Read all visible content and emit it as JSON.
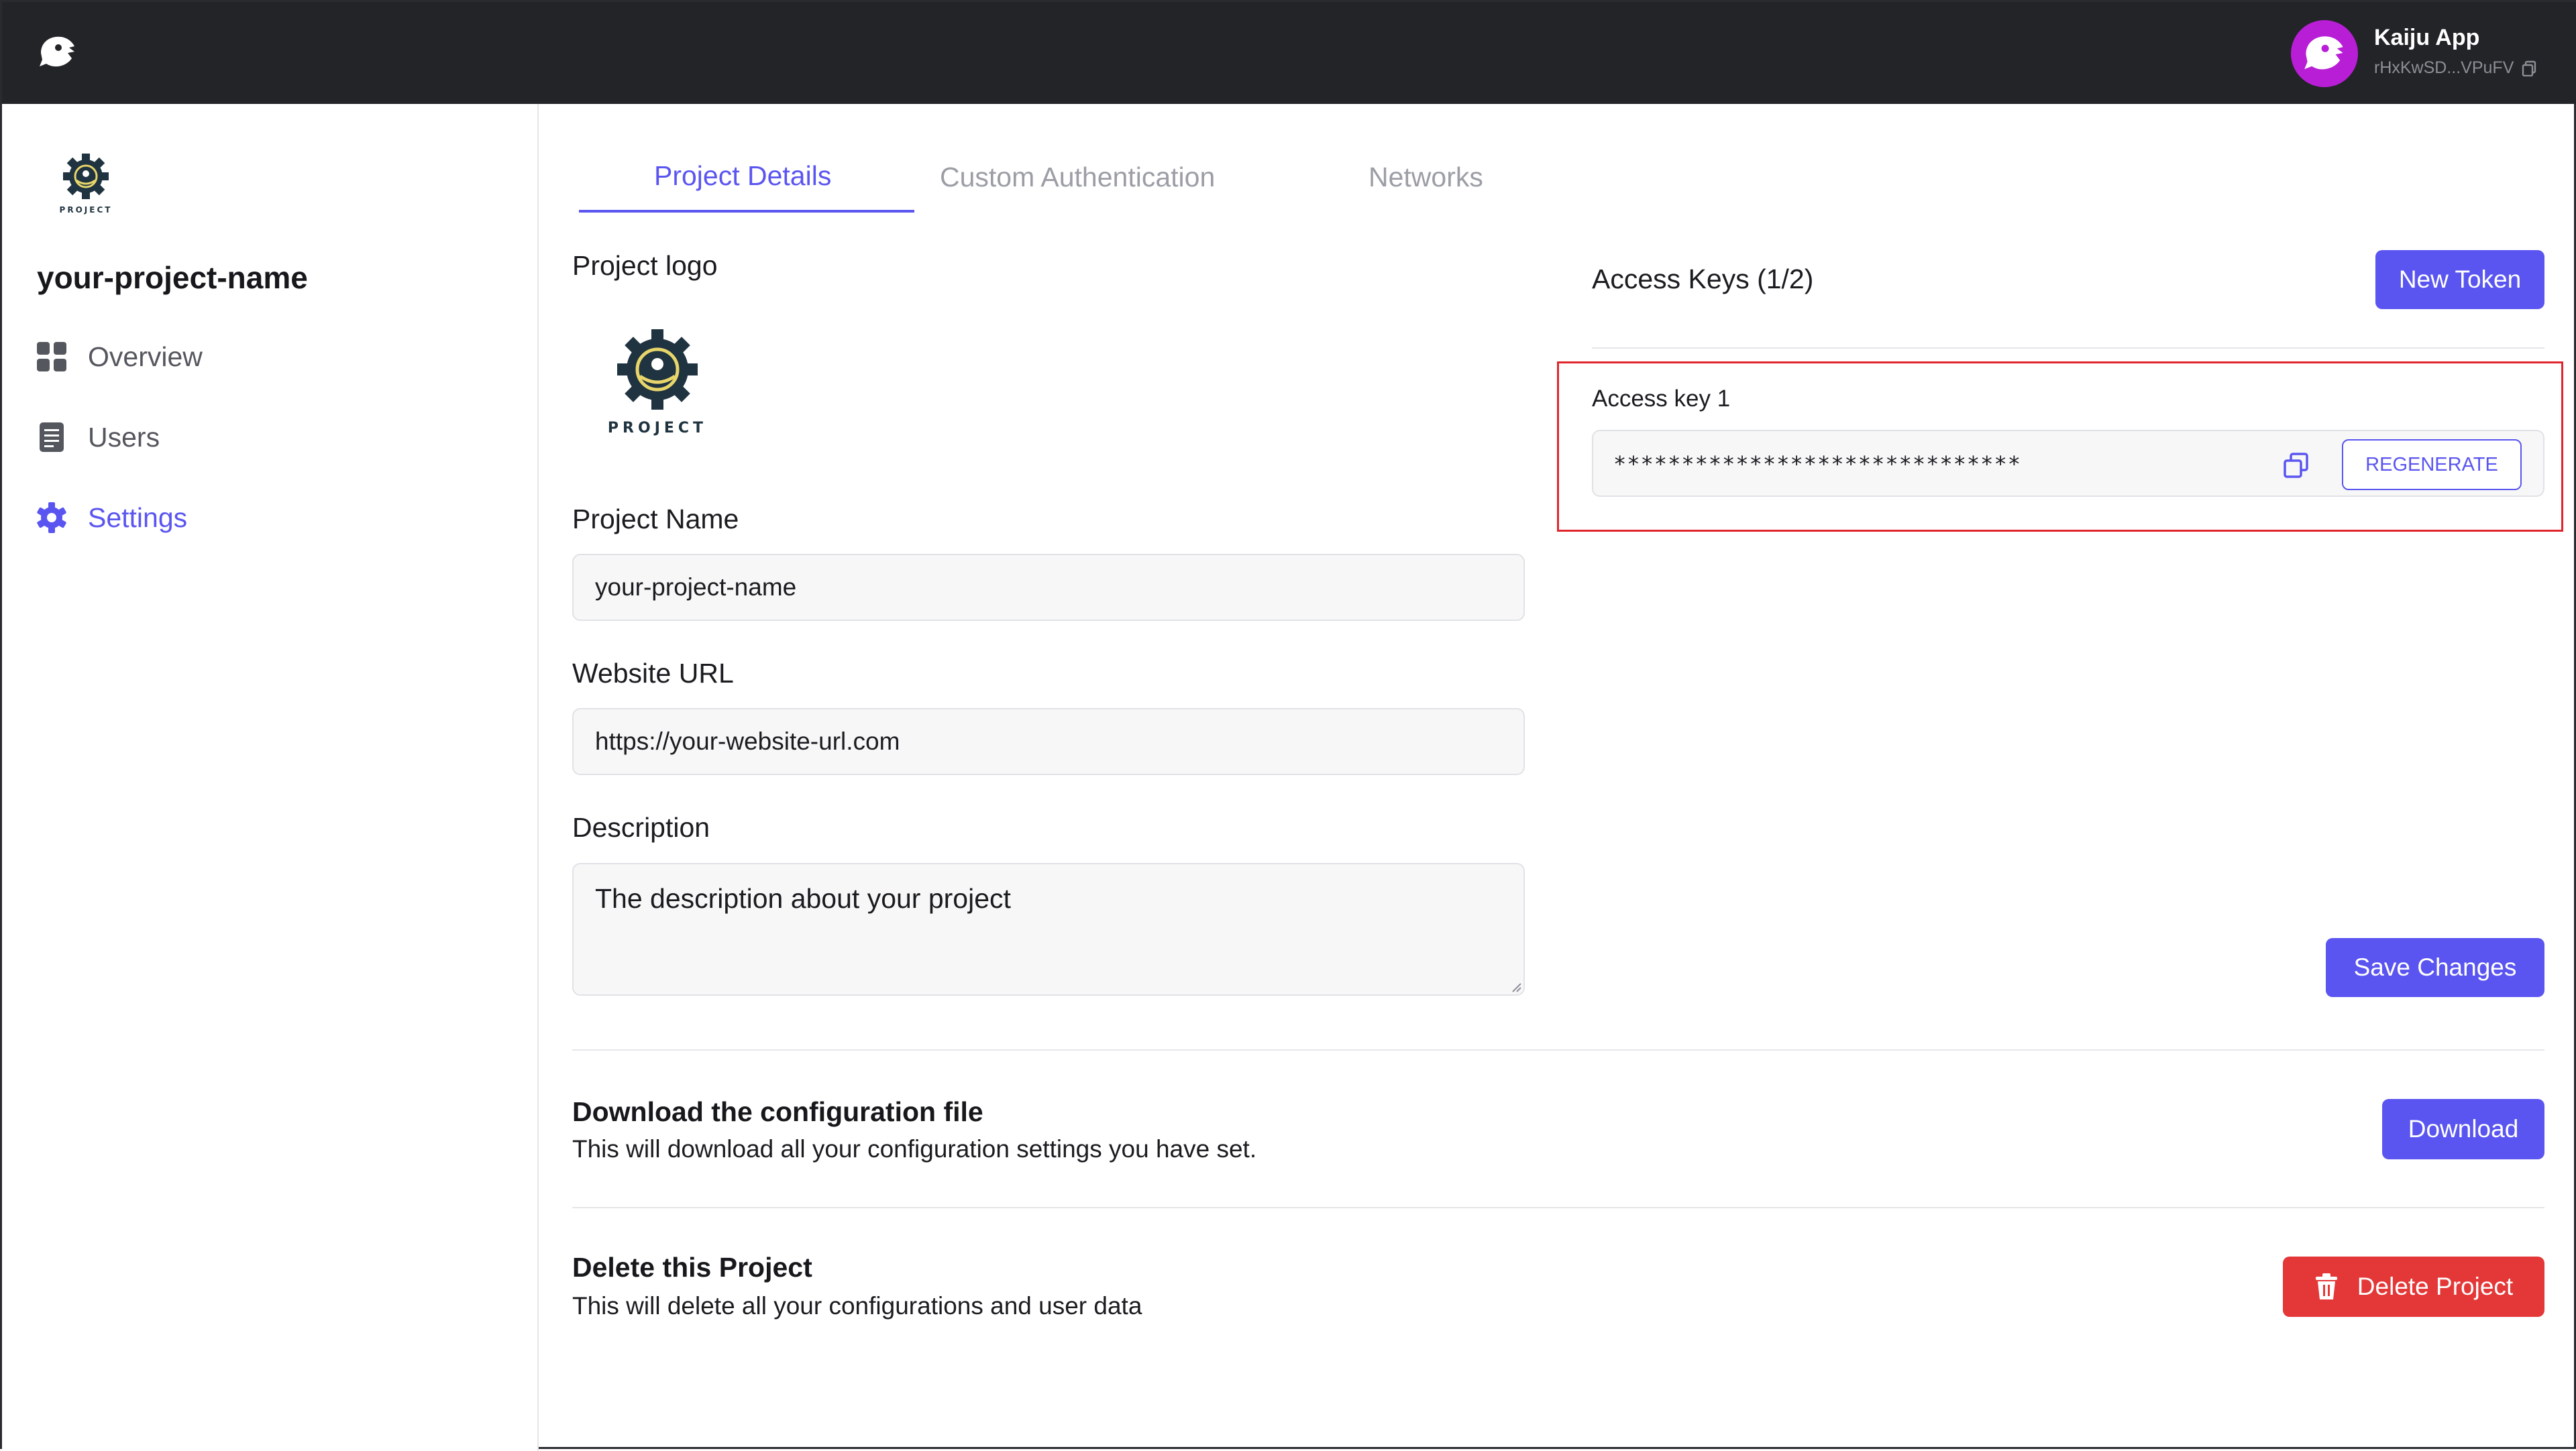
{
  "topbar": {
    "brand_icon": "kaiju-logo-icon",
    "app_name": "Kaiju App",
    "app_address": "rHxKwSD...VPuFV",
    "copy_icon": "copy-icon"
  },
  "sidebar": {
    "project_title": "your-project-name",
    "logo_text": "PROJECT",
    "items": [
      {
        "label": "Overview",
        "icon": "grid-icon"
      },
      {
        "label": "Users",
        "icon": "document-icon"
      },
      {
        "label": "Settings",
        "icon": "gear-icon",
        "active": true
      }
    ]
  },
  "tabs": [
    {
      "label": "Project Details",
      "active": true
    },
    {
      "label": "Custom Authentication"
    },
    {
      "label": "Networks"
    }
  ],
  "project_details": {
    "logo_label": "Project logo",
    "logo_text": "PROJECT",
    "name_label": "Project Name",
    "name_value": "your-project-name",
    "url_label": "Website URL",
    "url_value": "https://your-website-url.com",
    "description_label": "Description",
    "description_value": "The description about your project"
  },
  "access_keys": {
    "title": "Access Keys (1/2)",
    "new_token_label": "New Token",
    "keys": [
      {
        "label": "Access key 1",
        "value": "******************************",
        "regenerate_label": "REGENERATE"
      }
    ]
  },
  "save_changes_label": "Save Changes",
  "download_section": {
    "title": "Download the configuration file",
    "description": "This will download all your configuration settings you have set.",
    "button_label": "Download"
  },
  "delete_section": {
    "title": "Delete this Project",
    "description": "This will delete all your configurations and user data",
    "button_label": "Delete Project",
    "button_icon": "trash-icon"
  },
  "colors": {
    "accent": "#5a55f0",
    "danger": "#e43838",
    "topbar": "#232428",
    "avatar": "#b81ed6",
    "highlight": "#e0262d"
  }
}
